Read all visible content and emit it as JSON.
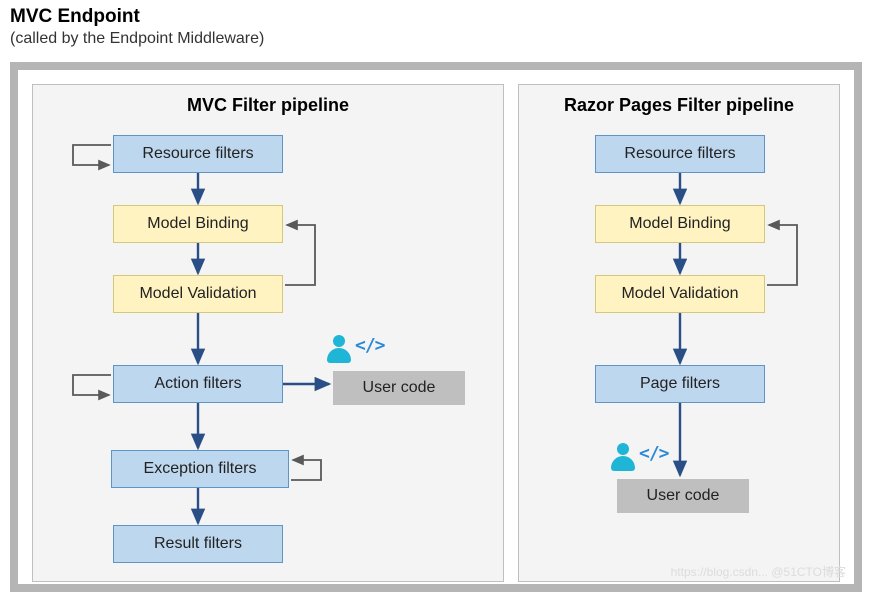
{
  "header": {
    "title": "MVC Endpoint",
    "subtitle": "(called by the Endpoint Middleware)"
  },
  "left_panel": {
    "title": "MVC Filter pipeline",
    "boxes": {
      "resource": "Resource filters",
      "model_binding": "Model Binding",
      "model_validation": "Model Validation",
      "action": "Action filters",
      "exception": "Exception filters",
      "result": "Result filters",
      "user_code": "User code"
    }
  },
  "right_panel": {
    "title": "Razor Pages Filter pipeline",
    "boxes": {
      "resource": "Resource filters",
      "model_binding": "Model Binding",
      "model_validation": "Model Validation",
      "page": "Page filters",
      "user_code": "User code"
    }
  },
  "code_glyph": "</>",
  "watermark": "https://blog.csdn... @51CTO博客",
  "colors": {
    "blue_fill": "#bdd7ee",
    "blue_border": "#5d95c6",
    "yellow_fill": "#fff3c2",
    "yellow_border": "#d6c77a",
    "gray_fill": "#bfbfbf",
    "arrow": "#2a4f86",
    "loop": "#595959",
    "icon": "#1fb5d6"
  }
}
